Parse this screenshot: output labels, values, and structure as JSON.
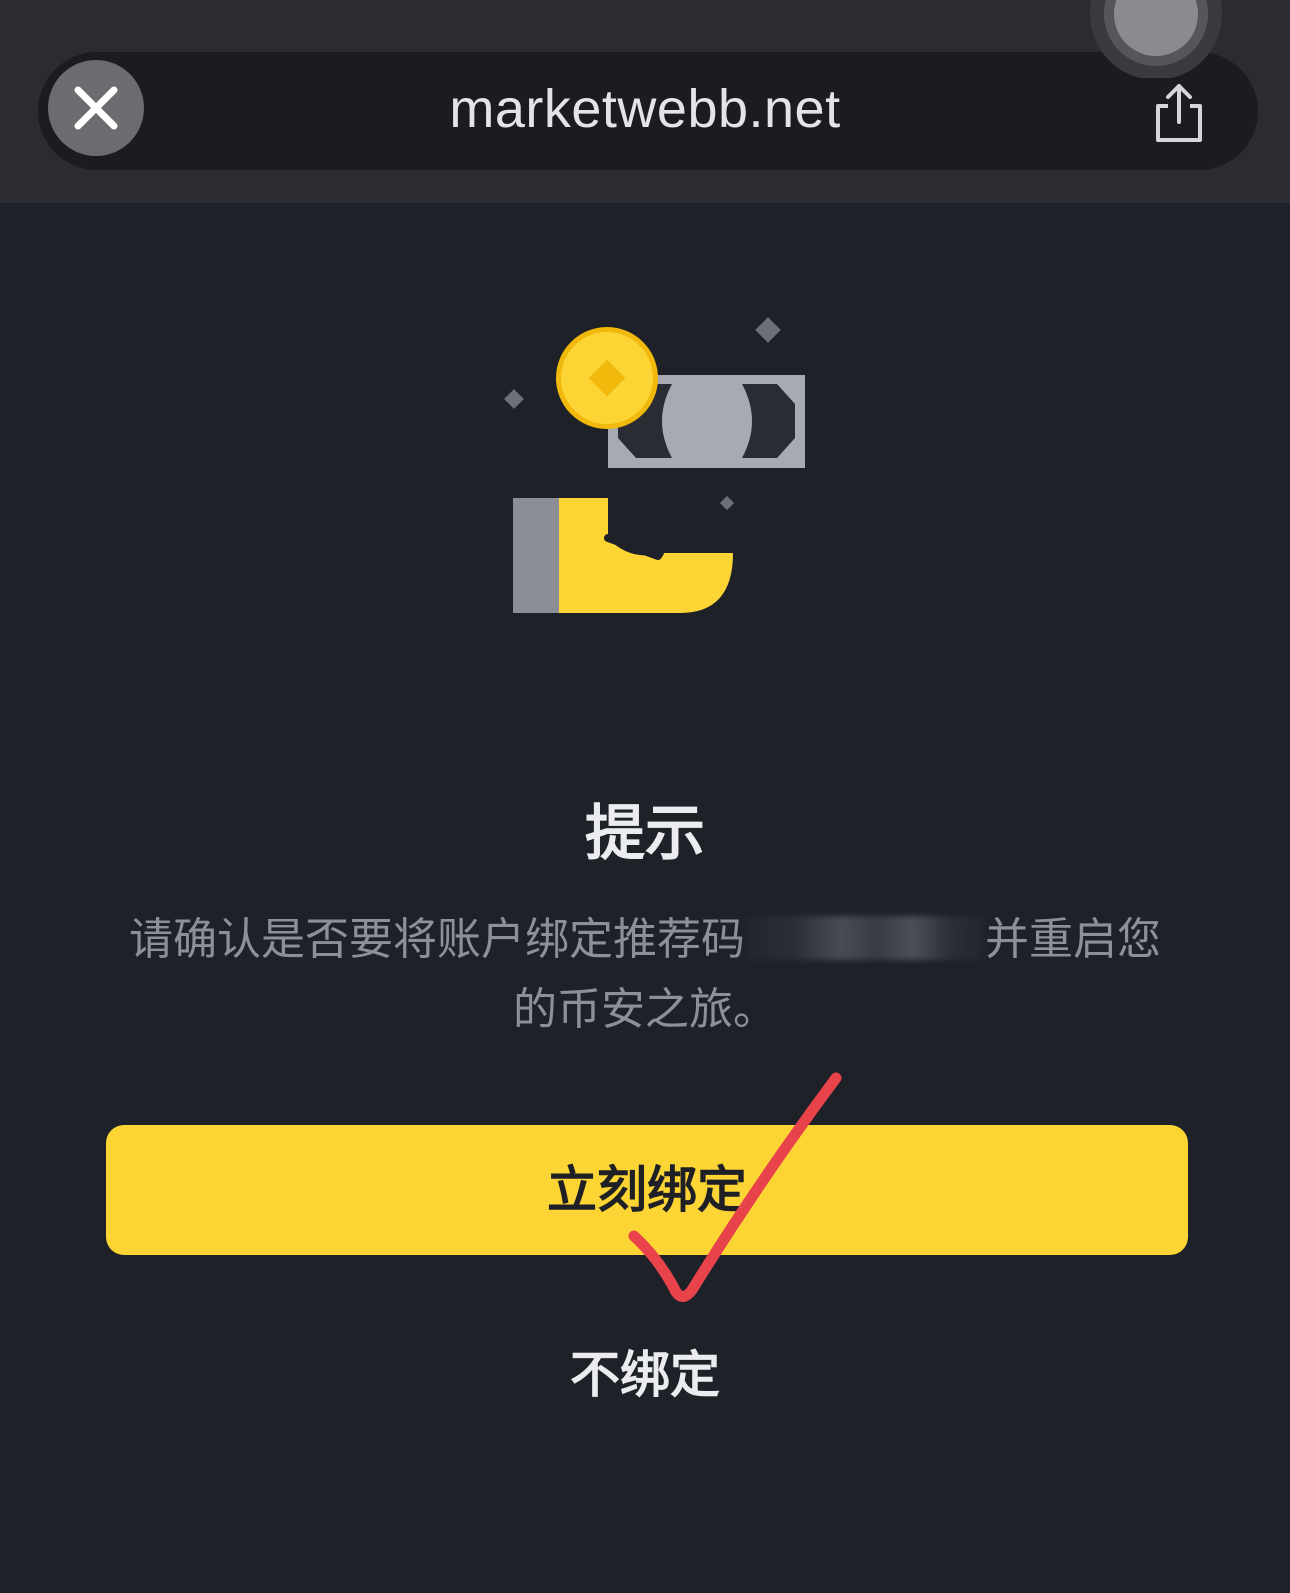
{
  "browser": {
    "url": "marketwebb.net",
    "close_icon": "close-icon",
    "share_icon": "share-icon"
  },
  "dialog": {
    "title": "提示",
    "message_before": "请确认是否要将账户绑定推荐码",
    "message_after": "并重启您的币安之旅。",
    "primary_button": "立刻绑定",
    "secondary_button": "不绑定"
  },
  "colors": {
    "background": "#1f2129",
    "accent": "#fcd535",
    "checkmark": "#e8424a"
  }
}
